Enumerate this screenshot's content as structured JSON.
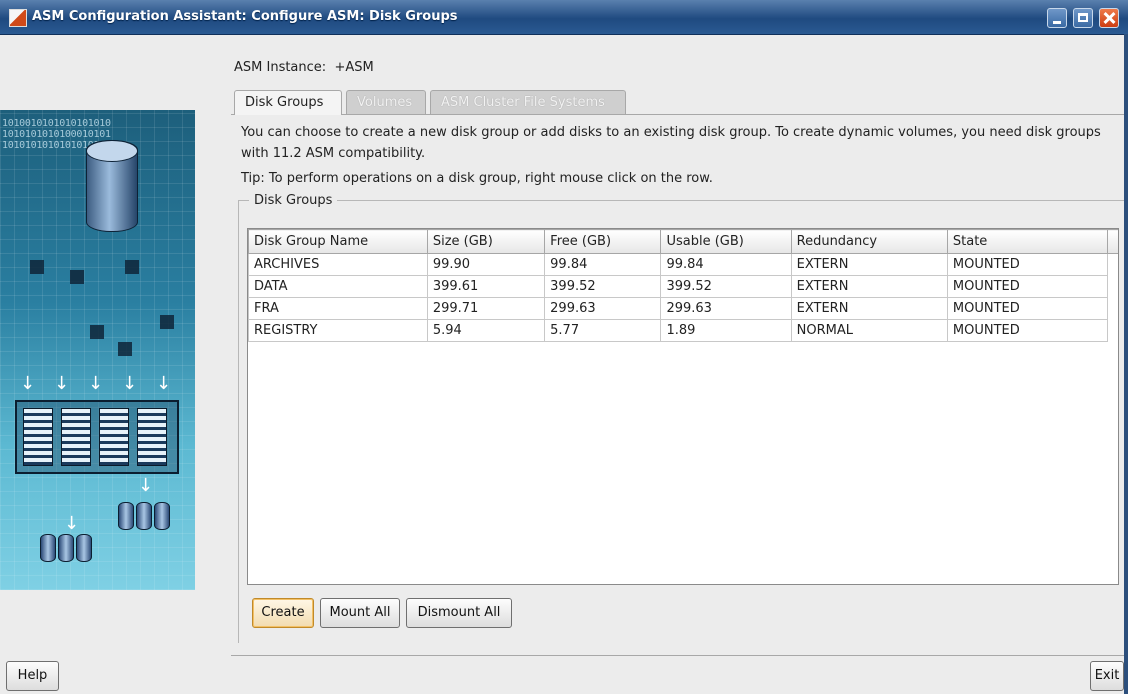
{
  "window": {
    "title": "ASM Configuration Assistant: Configure ASM: Disk Groups",
    "controls": [
      "minimize-icon",
      "maximize-icon",
      "close-icon"
    ]
  },
  "instance": {
    "label": "ASM Instance:",
    "value": "+ASM"
  },
  "tabs": [
    {
      "label": "Disk Groups",
      "state": "active"
    },
    {
      "label": "Volumes",
      "state": "disabled"
    },
    {
      "label": "ASM Cluster File Systems",
      "state": "disabled"
    }
  ],
  "side_image": {
    "binary_lines": [
      "1010010101010101010",
      "1010101010100010101",
      "1010101010101010101"
    ]
  },
  "description": "You can choose to create a new disk group or add disks to an existing disk group. To create dynamic volumes, you need disk groups with 11.2 ASM compatibility.",
  "tip": "Tip: To perform operations on a disk group, right mouse click on the row.",
  "disk_groups": {
    "legend": "Disk Groups",
    "columns": [
      "Disk Group Name",
      "Size (GB)",
      "Free (GB)",
      "Usable (GB)",
      "Redundancy",
      "State"
    ],
    "rows": [
      [
        "ARCHIVES",
        "99.90",
        "99.84",
        "99.84",
        "EXTERN",
        "MOUNTED"
      ],
      [
        "DATA",
        "399.61",
        "399.52",
        "399.52",
        "EXTERN",
        "MOUNTED"
      ],
      [
        "FRA",
        "299.71",
        "299.63",
        "299.63",
        "EXTERN",
        "MOUNTED"
      ],
      [
        "REGISTRY",
        "5.94",
        "5.77",
        "1.89",
        "NORMAL",
        "MOUNTED"
      ]
    ]
  },
  "buttons": {
    "create": "Create",
    "mount_all": "Mount All",
    "dismount_all": "Dismount All",
    "help": "Help",
    "exit": "Exit"
  },
  "colors": {
    "titlebar": "#2a5a92",
    "close_button": "#cc3d12",
    "create_focus": "#f3c065"
  }
}
